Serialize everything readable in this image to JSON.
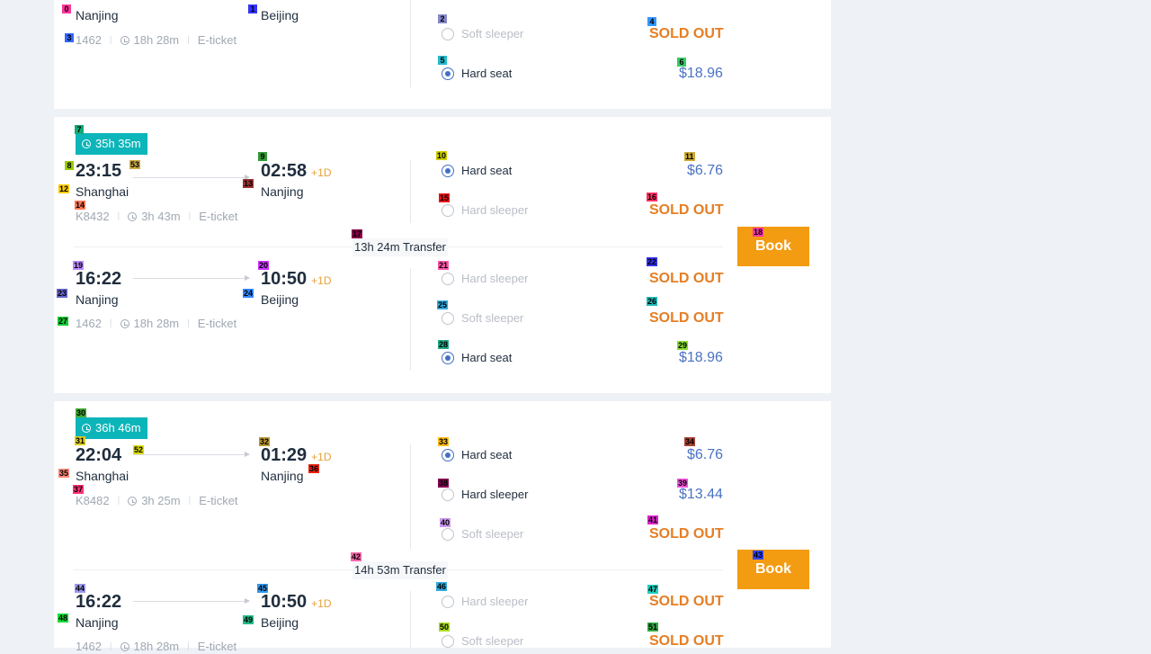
{
  "colors": {
    "accent": "#0bb5b9",
    "book": "#f39c12",
    "sold_out": "#e67e22",
    "price": "#4a72c4",
    "radio": "#4070c8"
  },
  "cards": [
    {
      "legs": [
        {
          "depart_city": "Nanjing",
          "arrive_city": "Beijing",
          "train": "1462",
          "duration": "18h 28m",
          "ticket": "E-ticket",
          "seats": [
            {
              "class": "Soft sleeper",
              "state": "disabled",
              "availability": "SOLD OUT"
            },
            {
              "class": "Hard seat",
              "state": "selected",
              "price": "$18.96"
            }
          ]
        }
      ]
    },
    {
      "total_duration": "35h 35m",
      "book_label": "Book",
      "transfer": "13h 24m Transfer",
      "legs": [
        {
          "depart_time": "23:15",
          "depart_city": "Shanghai",
          "arrive_time": "02:58",
          "day_offset": "+1D",
          "arrive_city": "Nanjing",
          "train": "K8432",
          "duration": "3h 43m",
          "ticket": "E-ticket",
          "seats": [
            {
              "class": "Hard seat",
              "state": "selected",
              "price": "$6.76"
            },
            {
              "class": "Hard sleeper",
              "state": "disabled",
              "availability": "SOLD OUT"
            }
          ]
        },
        {
          "depart_time": "16:22",
          "depart_city": "Nanjing",
          "arrive_time": "10:50",
          "day_offset": "+1D",
          "arrive_city": "Beijing",
          "train": "1462",
          "duration": "18h 28m",
          "ticket": "E-ticket",
          "seats": [
            {
              "class": "Hard sleeper",
              "state": "disabled",
              "availability": "SOLD OUT"
            },
            {
              "class": "Soft sleeper",
              "state": "disabled",
              "availability": "SOLD OUT"
            },
            {
              "class": "Hard seat",
              "state": "selected",
              "price": "$18.96"
            }
          ]
        }
      ]
    },
    {
      "total_duration": "36h 46m",
      "book_label": "Book",
      "transfer": "14h 53m Transfer",
      "legs": [
        {
          "depart_time": "22:04",
          "depart_city": "Shanghai",
          "arrive_time": "01:29",
          "day_offset": "+1D",
          "arrive_city": "Nanjing",
          "train": "K8482",
          "duration": "3h 25m",
          "ticket": "E-ticket",
          "seats": [
            {
              "class": "Hard seat",
              "state": "selected",
              "price": "$6.76"
            },
            {
              "class": "Hard sleeper",
              "state": "available",
              "price": "$13.44"
            },
            {
              "class": "Soft sleeper",
              "state": "disabled",
              "availability": "SOLD OUT"
            }
          ]
        },
        {
          "depart_time": "16:22",
          "depart_city": "Nanjing",
          "arrive_time": "10:50",
          "day_offset": "+1D",
          "arrive_city": "Beijing",
          "train": "1462",
          "duration": "18h 28m",
          "ticket": "E-ticket",
          "seats": [
            {
              "class": "Hard sleeper",
              "state": "disabled",
              "availability": "SOLD OUT"
            },
            {
              "class": "Soft sleeper",
              "state": "disabled",
              "availability": "SOLD OUT"
            }
          ]
        }
      ]
    }
  ],
  "marks": [
    {
      "n": "0",
      "c": "#ff3399"
    },
    {
      "n": "1",
      "c": "#3333ff"
    },
    {
      "n": "2",
      "c": "#8888cc"
    },
    {
      "n": "3",
      "c": "#3366ff"
    },
    {
      "n": "4",
      "c": "#3399ff"
    },
    {
      "n": "5",
      "c": "#22bbcc"
    },
    {
      "n": "6",
      "c": "#33cc66"
    },
    {
      "n": "7",
      "c": "#11aa77"
    },
    {
      "n": "8",
      "c": "#99cc00"
    },
    {
      "n": "9",
      "c": "#339933"
    },
    {
      "n": "10",
      "c": "#cccc00"
    },
    {
      "n": "11",
      "c": "#ccaa33"
    },
    {
      "n": "12",
      "c": "#ffcc00"
    },
    {
      "n": "13",
      "c": "#993333"
    },
    {
      "n": "14",
      "c": "#ff7755"
    },
    {
      "n": "15",
      "c": "#ee1111"
    },
    {
      "n": "16",
      "c": "#ff3366"
    },
    {
      "n": "17",
      "c": "#880044"
    },
    {
      "n": "18",
      "c": "#ff33aa"
    },
    {
      "n": "19",
      "c": "#bb88ff"
    },
    {
      "n": "20",
      "c": "#cc33ff"
    },
    {
      "n": "21",
      "c": "#ff55aa"
    },
    {
      "n": "22",
      "c": "#3333ee"
    },
    {
      "n": "23",
      "c": "#6666cc"
    },
    {
      "n": "24",
      "c": "#3388ff"
    },
    {
      "n": "25",
      "c": "#33aadd"
    },
    {
      "n": "26",
      "c": "#22bbbb"
    },
    {
      "n": "27",
      "c": "#11cc33"
    },
    {
      "n": "28",
      "c": "#22aa88"
    },
    {
      "n": "29",
      "c": "#88dd33"
    },
    {
      "n": "30",
      "c": "#44aa33"
    },
    {
      "n": "31",
      "c": "#ddcc22"
    },
    {
      "n": "52",
      "c": "#dddd00"
    },
    {
      "n": "32",
      "c": "#bb9933"
    },
    {
      "n": "33",
      "c": "#ffbb11"
    },
    {
      "n": "34",
      "c": "#aa4433"
    },
    {
      "n": "35",
      "c": "#ff8877"
    },
    {
      "n": "36",
      "c": "#ee2211"
    },
    {
      "n": "37",
      "c": "#ff3377"
    },
    {
      "n": "38",
      "c": "#880055"
    },
    {
      "n": "39",
      "c": "#ee55dd"
    },
    {
      "n": "40",
      "c": "#cc99ee"
    },
    {
      "n": "41",
      "c": "#dd22cc"
    },
    {
      "n": "42",
      "c": "#ff66aa"
    },
    {
      "n": "43",
      "c": "#3344ff"
    },
    {
      "n": "44",
      "c": "#9999ee"
    },
    {
      "n": "45",
      "c": "#3399ee"
    },
    {
      "n": "46",
      "c": "#33aadd"
    },
    {
      "n": "47",
      "c": "#22ccbb"
    },
    {
      "n": "48",
      "c": "#11dd33"
    },
    {
      "n": "49",
      "c": "#22bb88"
    },
    {
      "n": "50",
      "c": "#aadd22"
    },
    {
      "n": "51",
      "c": "#33aa44"
    },
    {
      "n": "53",
      "c": "#ccaa44"
    }
  ]
}
